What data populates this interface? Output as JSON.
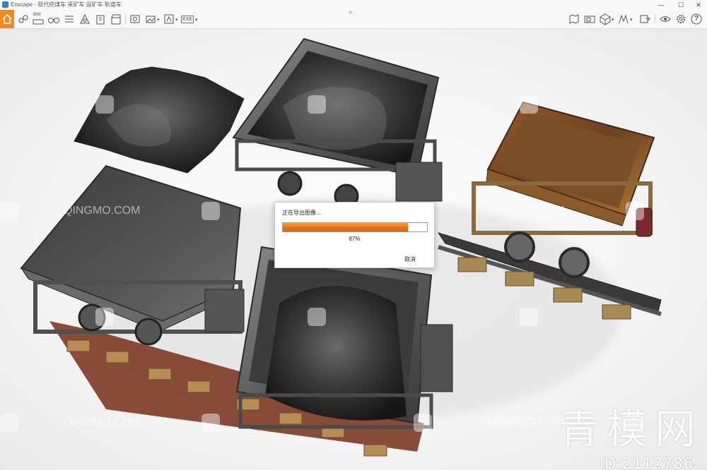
{
  "window": {
    "title": "Enscape - 现代挖煤车 采矿车 运矿车 轨道车",
    "minimize_glyph": "—",
    "maximize_glyph": "☐",
    "close_glyph": "✕"
  },
  "toolbar": {
    "accent_color": "#f08a1e",
    "left_icons": [
      "home-icon",
      "link-icon",
      "bim-icon",
      "binoculars-icon",
      "list-icon",
      "pin-icon",
      "building-icon",
      "clapperboard-icon",
      "screenshot-icon",
      "panorama-icon",
      "batch-render-icon",
      "exe-export-icon"
    ],
    "right_icons": [
      "map-icon",
      "video-icon",
      "asset-cube-icon",
      "atlas-icon",
      "visual-settings-icon",
      "eye-icon",
      "settings-icon",
      "help-icon"
    ],
    "bim_label": "BIM",
    "exe_label": "EXE",
    "help_label": "?",
    "collapse_glyph": "^"
  },
  "dialog": {
    "title": "正在导出图像...",
    "progress_percent": 87,
    "progress_label": "87%",
    "cancel_label": "取消",
    "progress_color": "#ea6f0d"
  },
  "watermark": {
    "small_text": "QINGMO.COM",
    "brand_text": "青模网",
    "id_text": "ID:2112786"
  }
}
